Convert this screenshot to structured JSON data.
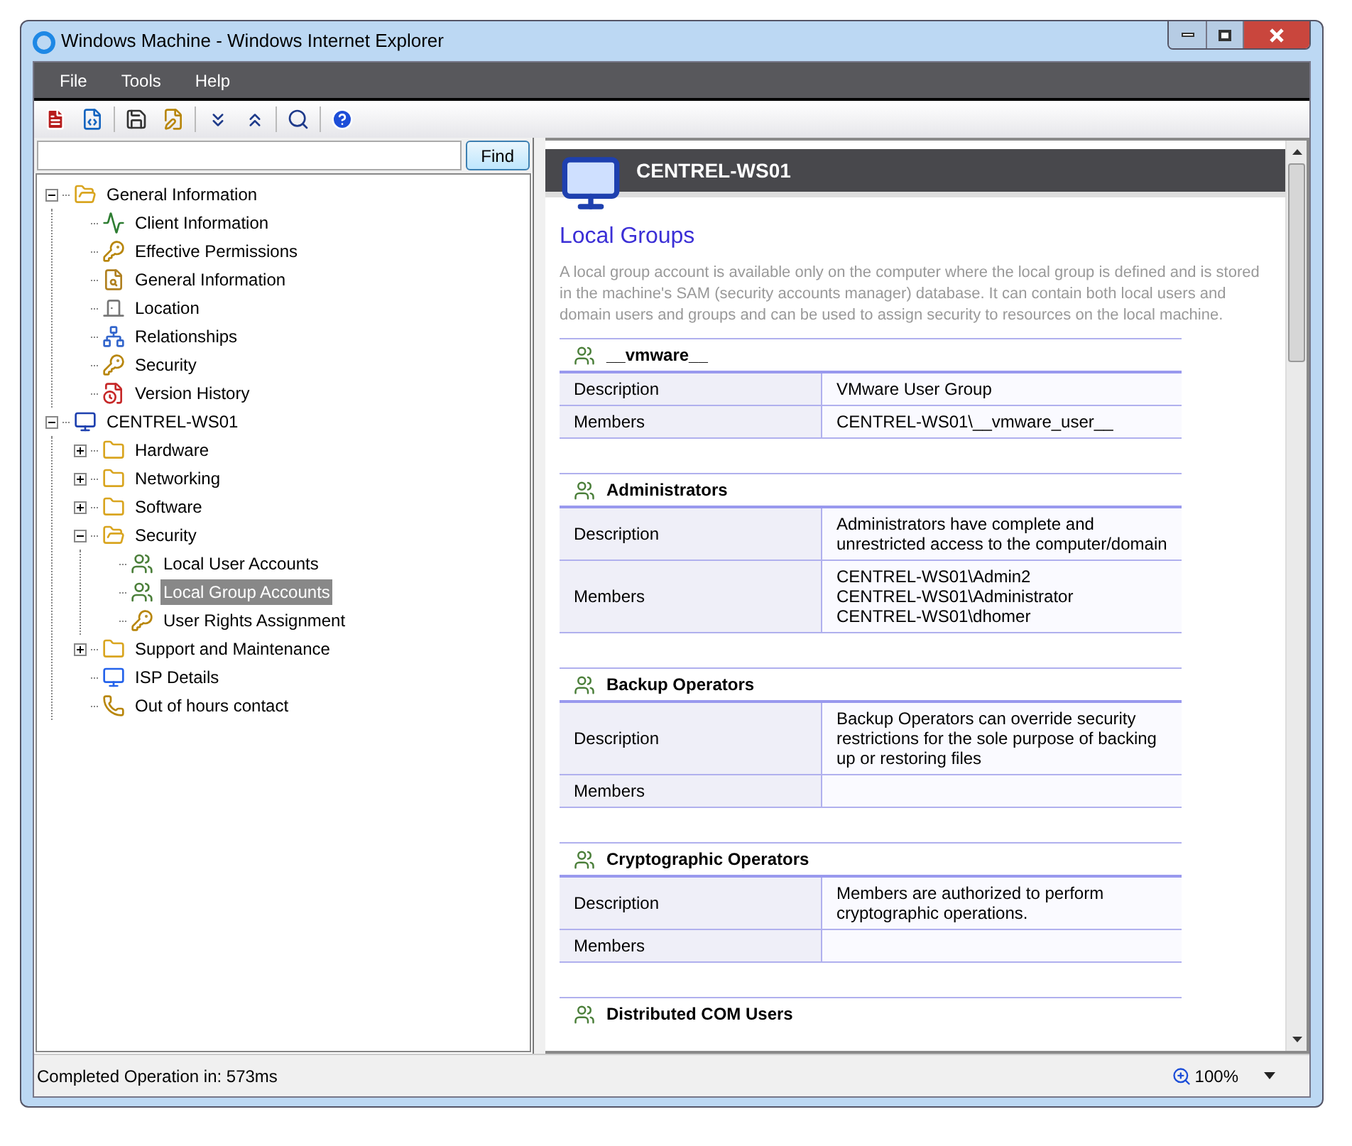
{
  "window": {
    "title": "Windows Machine - Windows Internet Explorer"
  },
  "menu": [
    "File",
    "Tools",
    "Help"
  ],
  "search": {
    "button": "Find"
  },
  "tree": [
    {
      "label": "General Information",
      "kind": "folder",
      "expanded": true,
      "selected": false,
      "children": [
        {
          "label": "Client Information",
          "kind": "chart",
          "selected": false
        },
        {
          "label": "Effective Permissions",
          "kind": "keys",
          "selected": false
        },
        {
          "label": "General Information",
          "kind": "search-folder",
          "selected": false
        },
        {
          "label": "Location",
          "kind": "door",
          "selected": false
        },
        {
          "label": "Relationships",
          "kind": "diagram",
          "selected": false
        },
        {
          "label": "Security",
          "kind": "keys",
          "selected": false
        },
        {
          "label": "Version History",
          "kind": "version",
          "selected": false
        }
      ]
    },
    {
      "label": "CENTREL-WS01",
      "kind": "computer",
      "expanded": true,
      "selected": false,
      "children": [
        {
          "label": "Hardware",
          "kind": "folder",
          "expanded": false,
          "selected": false
        },
        {
          "label": "Networking",
          "kind": "folder",
          "expanded": false,
          "selected": false
        },
        {
          "label": "Software",
          "kind": "folder",
          "expanded": false,
          "selected": false
        },
        {
          "label": "Security",
          "kind": "folder",
          "expanded": true,
          "selected": false,
          "children": [
            {
              "label": "Local User Accounts",
              "kind": "users",
              "selected": false
            },
            {
              "label": "Local Group Accounts",
              "kind": "users",
              "selected": true
            },
            {
              "label": "User Rights Assignment",
              "kind": "keys",
              "selected": false
            }
          ]
        },
        {
          "label": "Support and Maintenance",
          "kind": "folder",
          "expanded": false,
          "selected": false
        },
        {
          "label": "ISP Details",
          "kind": "network-pc",
          "selected": false
        },
        {
          "label": "Out of hours contact",
          "kind": "phone",
          "selected": false
        }
      ]
    }
  ],
  "report": {
    "machine": "CENTREL-WS01",
    "heading": "Local Groups",
    "description": "A local group account is available only on the computer where the local group is defined and is stored in the machine's SAM (security accounts manager) database. It can contain both local users and domain users and groups and can be used to assign security to resources on the local machine.",
    "groups": [
      {
        "name": "__vmware__",
        "rows": [
          {
            "label": "Description",
            "lines": [
              "VMware User Group"
            ]
          },
          {
            "label": "Members",
            "lines": [
              "CENTREL-WS01\\__vmware_user__"
            ]
          }
        ]
      },
      {
        "name": "Administrators",
        "rows": [
          {
            "label": "Description",
            "lines": [
              "Administrators have complete and unrestricted access to the computer/domain"
            ]
          },
          {
            "label": "Members",
            "lines": [
              "CENTREL-WS01\\Admin2",
              "CENTREL-WS01\\Administrator",
              "CENTREL-WS01\\dhomer"
            ]
          }
        ]
      },
      {
        "name": "Backup Operators",
        "rows": [
          {
            "label": "Description",
            "lines": [
              "Backup Operators can override security restrictions for the sole purpose of backing up or restoring files"
            ]
          },
          {
            "label": "Members"
          }
        ]
      },
      {
        "name": "Cryptographic Operators",
        "rows": [
          {
            "label": "Description",
            "lines": [
              "Members are authorized to perform cryptographic operations."
            ]
          },
          {
            "label": "Members"
          }
        ]
      },
      {
        "name": "Distributed COM Users"
      }
    ]
  },
  "status_bar": {
    "text": "Completed Operation in: 573ms",
    "zoom": "100%"
  }
}
